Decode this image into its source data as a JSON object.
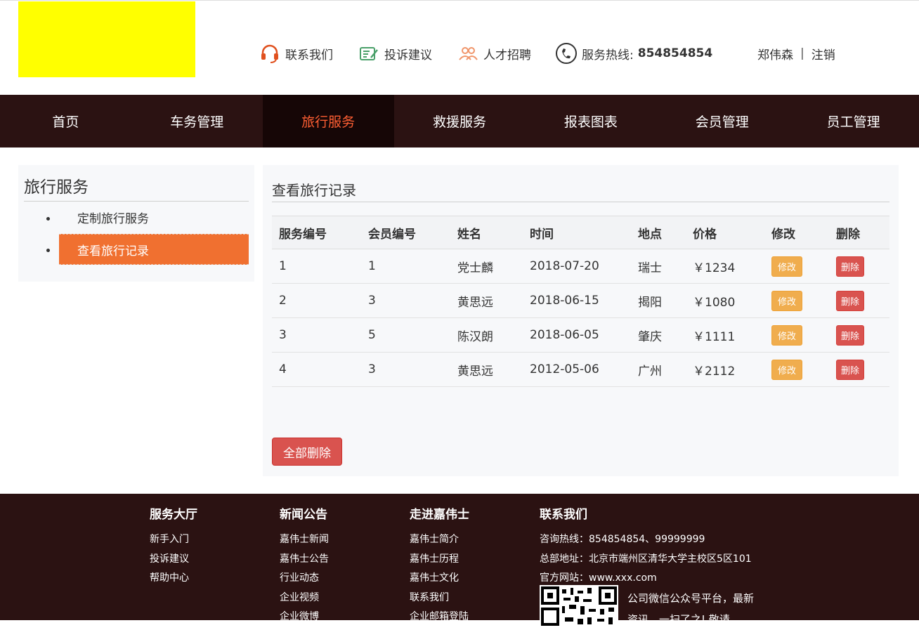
{
  "header": {
    "links": [
      {
        "label": "联系我们",
        "icon": "headset-icon"
      },
      {
        "label": "投诉建议",
        "icon": "feedback-icon"
      },
      {
        "label": "人才招聘",
        "icon": "people-icon"
      }
    ],
    "hotline_label": "服务热线:",
    "hotline_number": "854854854",
    "user_name": "郑伟森",
    "separator": "|",
    "logout_label": "注销"
  },
  "nav": {
    "items": [
      "首页",
      "车务管理",
      "旅行服务",
      "救援服务",
      "报表图表",
      "会员管理",
      "员工管理"
    ],
    "active_index": 2
  },
  "sidebar": {
    "title": "旅行服务",
    "items": [
      "定制旅行服务",
      "查看旅行记录"
    ],
    "active_index": 1
  },
  "main": {
    "title": "查看旅行记录",
    "table": {
      "headers": [
        "服务编号",
        "会员编号",
        "姓名",
        "时间",
        "地点",
        "价格",
        "修改",
        "删除"
      ],
      "rows": [
        {
          "service_id": "1",
          "member_id": "1",
          "name": "党士麟",
          "date": "2018-07-20",
          "place": "瑞士",
          "price": "￥1234"
        },
        {
          "service_id": "2",
          "member_id": "3",
          "name": "黄思远",
          "date": "2018-06-15",
          "place": "揭阳",
          "price": "￥1080"
        },
        {
          "service_id": "3",
          "member_id": "5",
          "name": "陈汉朗",
          "date": "2018-06-05",
          "place": "肇庆",
          "price": "￥1111"
        },
        {
          "service_id": "4",
          "member_id": "3",
          "name": "黄思远",
          "date": "2012-05-06",
          "place": "广州",
          "price": "￥2112"
        }
      ],
      "edit_label": "修改",
      "delete_label": "删除"
    },
    "delete_all_label": "全部删除"
  },
  "footer": {
    "columns": [
      {
        "title": "服务大厅",
        "links": [
          "新手入门",
          "投诉建议",
          "帮助中心"
        ]
      },
      {
        "title": "新闻公告",
        "links": [
          "嘉伟士新闻",
          "嘉伟士公告",
          "行业动态",
          "企业视频",
          "企业微博"
        ]
      },
      {
        "title": "走进嘉伟士",
        "links": [
          "嘉伟士简介",
          "嘉伟士历程",
          "嘉伟士文化",
          "联系我们",
          "企业邮箱登陆"
        ]
      }
    ],
    "contact": {
      "title": "联系我们",
      "lines": [
        "咨询热线：854854854、99999999",
        "总部地址：北京市端州区清华大学主校区5区101",
        "官方网站：www.xxx.com"
      ],
      "qr_text": "公司微信公众号平台，最新资讯，一扫了之! 敬请"
    }
  },
  "colors": {
    "nav_bg": "#2b1212",
    "nav_active_bg": "#160606",
    "nav_active_text": "#ff5f33",
    "sidebar_active_bg": "#f07030",
    "logo_placeholder": "#ffff00",
    "edit_button": "#f0ad4e",
    "delete_button": "#d9534f"
  }
}
